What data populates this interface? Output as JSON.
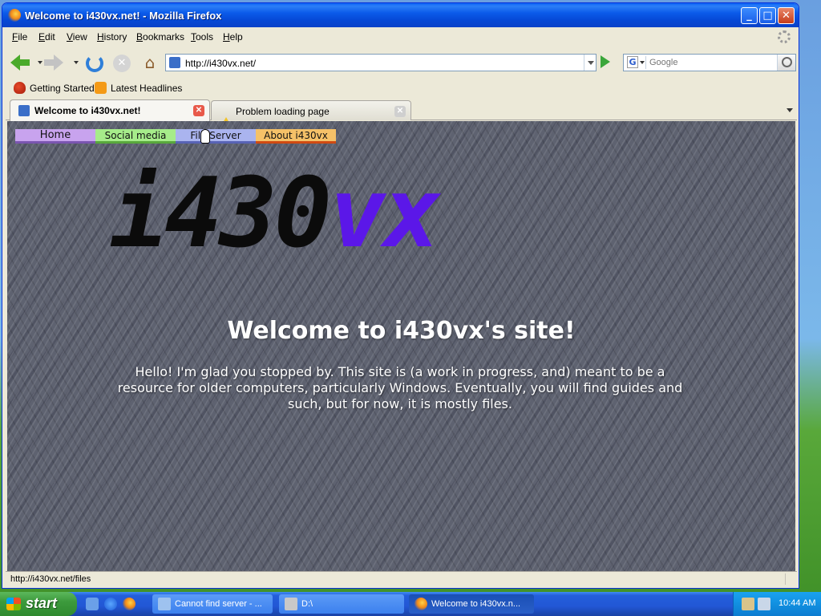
{
  "window": {
    "title": "Welcome to i430vx.net! - Mozilla Firefox",
    "controls": {
      "minimize": "_",
      "maximize": "□",
      "close": "✕"
    }
  },
  "menubar": {
    "items": [
      "File",
      "Edit",
      "View",
      "History",
      "Bookmarks",
      "Tools",
      "Help"
    ]
  },
  "navbar": {
    "url": "http://i430vx.net/",
    "search_placeholder": "Google",
    "search_engine_glyph": "G",
    "stop_glyph": "✕",
    "home_glyph": "⌂"
  },
  "bookmarks": {
    "items": [
      {
        "label": "Getting Started",
        "icon": "firefox-icon"
      },
      {
        "label": "Latest Headlines",
        "icon": "rss-icon"
      }
    ]
  },
  "tabs": [
    {
      "label": "Welcome to i430vx.net!",
      "active": true,
      "close_glyph": "✕"
    },
    {
      "label": "Problem loading page",
      "active": false,
      "close_glyph": "✕"
    }
  ],
  "page": {
    "nav": [
      {
        "label": "Home",
        "color": "#c8a3ee"
      },
      {
        "label": "Social media",
        "color": "#a6ec8a"
      },
      {
        "label": "File Server",
        "color": "#aab4ef"
      },
      {
        "label": "About i430vx",
        "color": "#f5c168"
      }
    ],
    "logo": {
      "part1": "i430",
      "part2": "vx",
      "colors": {
        "part1": "#0b0b0b",
        "part2": "#5b17e8"
      }
    },
    "heading": "Welcome to i430vx's site!",
    "intro": "Hello! I'm glad you stopped by. This site is (a work in progress, and) meant to be a resource for older computers, particularly Windows. Eventually, you will find guides and such, but for now, it is mostly files."
  },
  "statusbar": {
    "text": "http://i430vx.net/files"
  },
  "taskbar": {
    "start_label": "start",
    "tasks": [
      {
        "label": "Cannot find server - ...",
        "active": false,
        "icon": "ie-window-icon"
      },
      {
        "label": "D:\\",
        "active": false,
        "icon": "drive-icon"
      },
      {
        "label": "Welcome to i430vx.n...",
        "active": true,
        "icon": "firefox-icon"
      }
    ],
    "clock": "10:44 AM"
  }
}
